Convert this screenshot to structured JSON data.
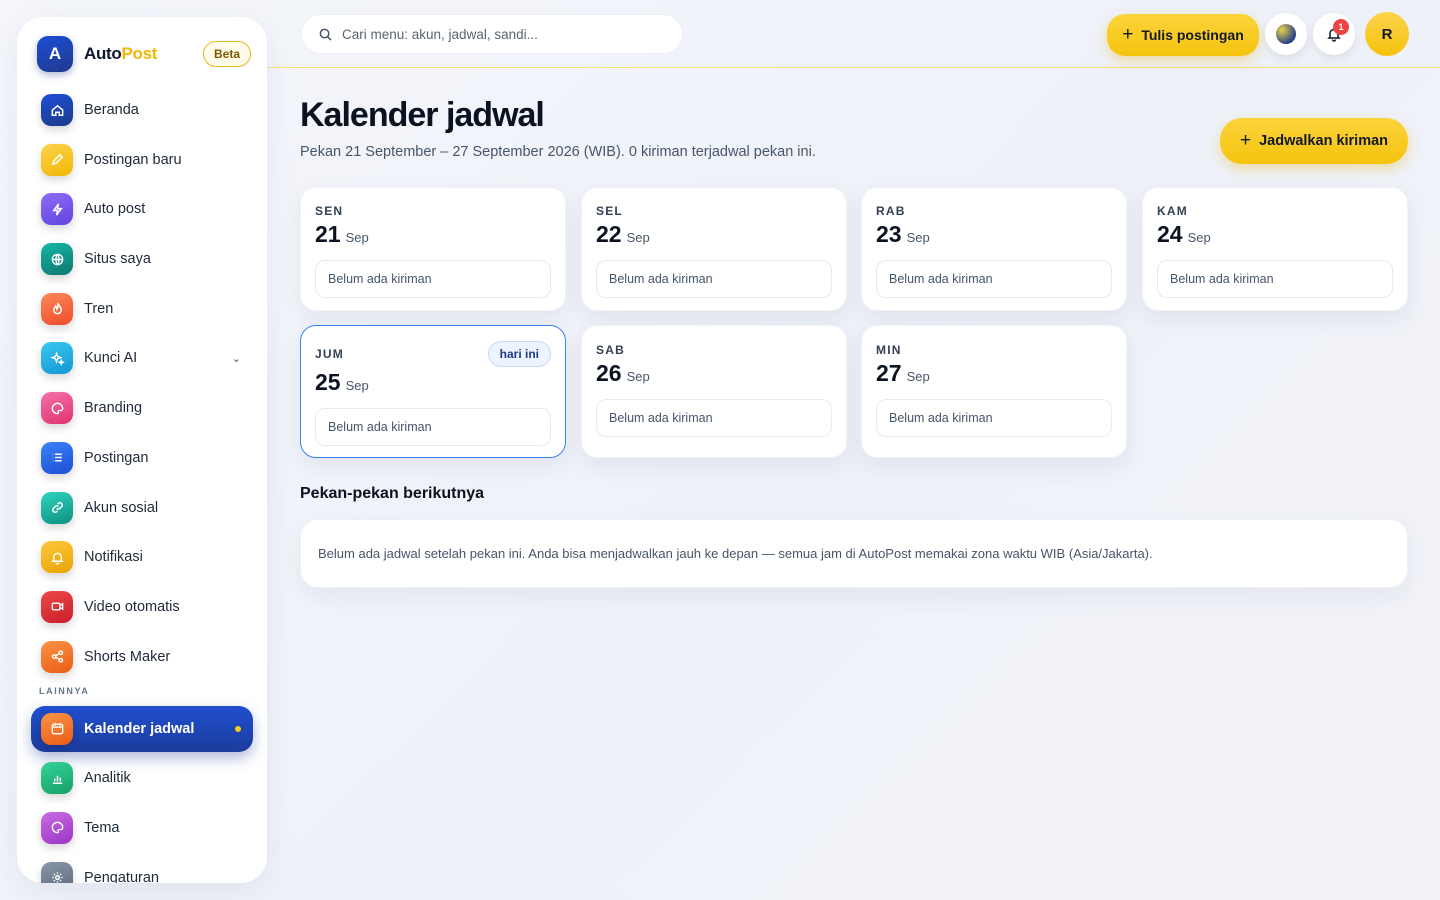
{
  "brand": {
    "name_part1": "Auto",
    "name_part2": "Post",
    "logo_letter": "A",
    "badge": "Beta"
  },
  "sidebar": {
    "items": [
      {
        "label": "Beranda",
        "icon": "home-icon",
        "color": "#1e3a8a"
      },
      {
        "label": "Postingan baru",
        "icon": "pencil-icon",
        "color": "#f5c518"
      },
      {
        "label": "Auto post",
        "icon": "bolt-icon",
        "color": "#7c5cf0"
      },
      {
        "label": "Situs saya",
        "icon": "globe-icon",
        "color": "#0d9488"
      },
      {
        "label": "Tren",
        "icon": "flame-icon",
        "color": "#f26b3a"
      },
      {
        "label": "Kunci AI",
        "icon": "sparkle-icon",
        "color": "#22b8e6"
      },
      {
        "label": "Branding",
        "icon": "palette-icon",
        "color": "#ec4d8f"
      },
      {
        "label": "Postingan",
        "icon": "list-icon",
        "color": "#2563eb"
      },
      {
        "label": "Akun sosial",
        "icon": "link-icon",
        "color": "#14a38b"
      },
      {
        "label": "Notifikasi",
        "icon": "bell-icon",
        "color": "#f5b50a"
      },
      {
        "label": "Video otomatis",
        "icon": "video-icon",
        "color": "#e0303a"
      },
      {
        "label": "Shorts Maker",
        "icon": "share-icon",
        "color": "#f57a2a"
      }
    ],
    "section_label": "LAINNYA",
    "other_items": [
      {
        "label": "Kalender jadwal",
        "icon": "calendar-icon",
        "color": "#f57a2a",
        "active": true
      },
      {
        "label": "Analitik",
        "icon": "chart-icon",
        "color": "#22c17a"
      },
      {
        "label": "Tema",
        "icon": "palette-icon",
        "color": "#b44fd6"
      },
      {
        "label": "Pengaturan",
        "icon": "gear-icon",
        "color": "#64748b"
      }
    ]
  },
  "topbar": {
    "search_placeholder": "Cari menu: akun, jadwal, sandi...",
    "write_button": "Tulis postingan",
    "notification_count": "1",
    "avatar_initial": "R"
  },
  "main": {
    "title": "Kalender jadwal",
    "subtitle": "Pekan 21 September – 27 September 2026 (WIB). 0 kiriman terjadwal pekan ini.",
    "schedule_button": "Jadwalkan kiriman",
    "today_label": "hari ini",
    "days": [
      {
        "dow": "SEN",
        "day": "21",
        "month": "Sep",
        "empty": "Belum ada kiriman",
        "today": false
      },
      {
        "dow": "SEL",
        "day": "22",
        "month": "Sep",
        "empty": "Belum ada kiriman",
        "today": false
      },
      {
        "dow": "RAB",
        "day": "23",
        "month": "Sep",
        "empty": "Belum ada kiriman",
        "today": false
      },
      {
        "dow": "KAM",
        "day": "24",
        "month": "Sep",
        "empty": "Belum ada kiriman",
        "today": false
      },
      {
        "dow": "JUM",
        "day": "25",
        "month": "Sep",
        "empty": "Belum ada kiriman",
        "today": true
      },
      {
        "dow": "SAB",
        "day": "26",
        "month": "Sep",
        "empty": "Belum ada kiriman",
        "today": false
      },
      {
        "dow": "MIN",
        "day": "27",
        "month": "Sep",
        "empty": "Belum ada kiriman",
        "today": false
      }
    ],
    "next_weeks_title": "Pekan-pekan berikutnya",
    "next_weeks_text": "Belum ada jadwal setelah pekan ini. Anda bisa menjadwalkan jauh ke depan — semua jam di AutoPost memakai zona waktu WIB (Asia/Jakarta)."
  },
  "colors": {
    "accent": "#f5c30d",
    "primary": "#1e40af",
    "today_border": "#3b82f6"
  }
}
